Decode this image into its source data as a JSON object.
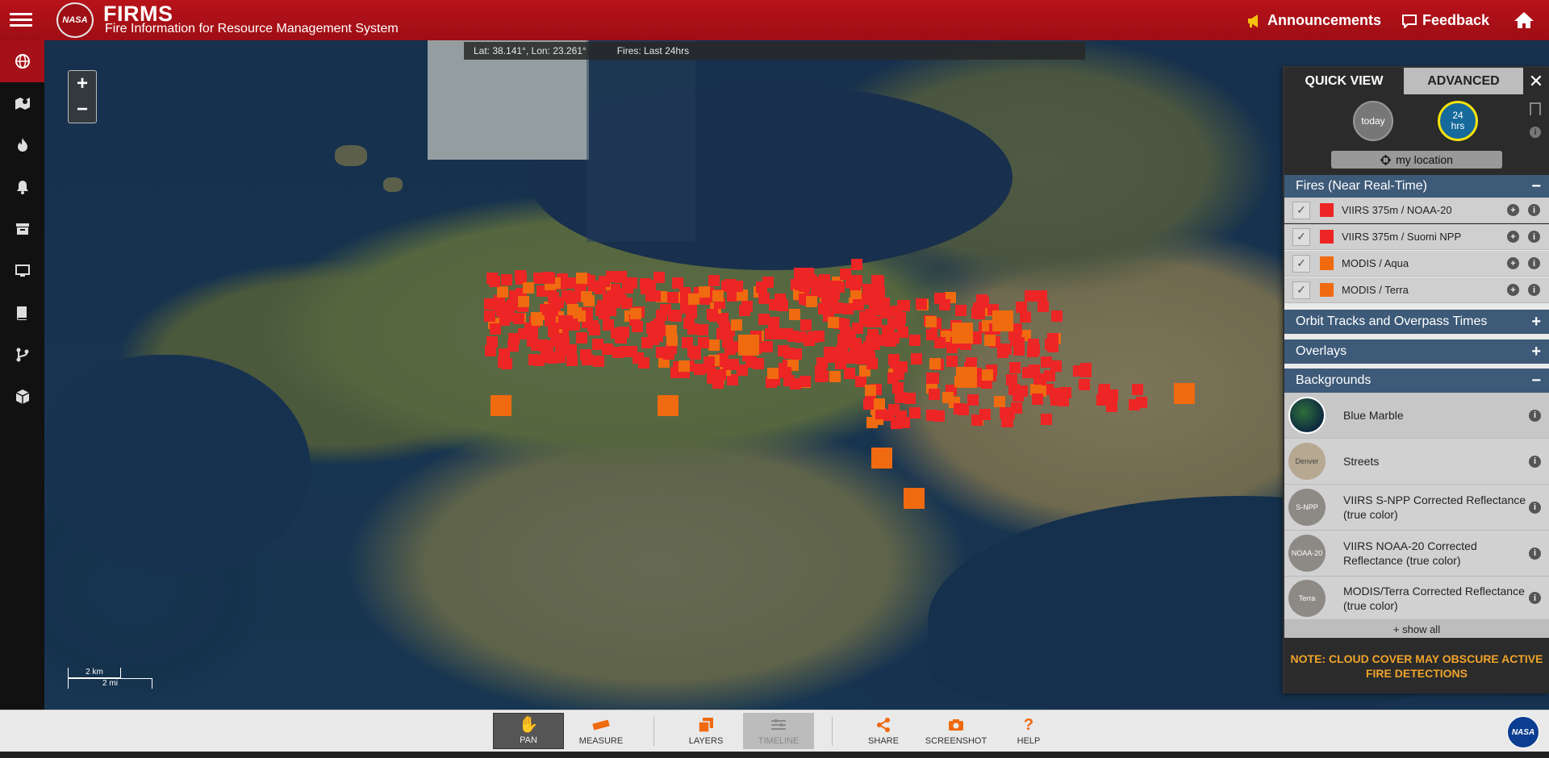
{
  "header": {
    "logo_text": "NASA",
    "title": "FIRMS",
    "subtitle": "Fire Information for Resource Management System",
    "announcements": "Announcements",
    "feedback": "Feedback"
  },
  "sidebar": {
    "items": [
      {
        "name": "globe-icon",
        "active": true
      },
      {
        "name": "map-marker-icon",
        "active": false
      },
      {
        "name": "fire-icon",
        "active": false
      },
      {
        "name": "bell-icon",
        "active": false
      },
      {
        "name": "archive-icon",
        "active": false
      },
      {
        "name": "monitor-icon",
        "active": false
      },
      {
        "name": "book-icon",
        "active": false
      },
      {
        "name": "branch-icon",
        "active": false
      },
      {
        "name": "cube-icon",
        "active": false
      }
    ]
  },
  "coordbar": {
    "location": "Lat: 38.141°, Lon: 23.261°",
    "fires": "Fires: Last 24hrs"
  },
  "zoom": {
    "in": "+",
    "out": "−"
  },
  "scale": {
    "km": "2 km",
    "mi": "2 mi"
  },
  "panel": {
    "tab_quick": "QUICK VIEW",
    "tab_advanced": "ADVANCED",
    "close": "✕",
    "today": "today",
    "hrs_num": "24",
    "hrs_label": "hrs",
    "my_location": "my location",
    "fires_section": "Fires (Near Real-Time)",
    "fires_toggle": "−",
    "fire_layers": [
      {
        "label": "VIIRS 375m / NOAA-20",
        "color": "#ed2525"
      },
      {
        "label": "VIIRS 375m / Suomi NPP",
        "color": "#ed2525"
      },
      {
        "label": "MODIS / Aqua",
        "color": "#f06a10"
      },
      {
        "label": "MODIS / Terra",
        "color": "#f06a10"
      }
    ],
    "orbit_section": "Orbit Tracks and Overpass Times",
    "overlays_section": "Overlays",
    "backgrounds_section": "Backgrounds",
    "plus": "+",
    "backgrounds": [
      {
        "label": "Blue Marble",
        "thumb": ""
      },
      {
        "label": "Streets",
        "thumb": "Denver"
      },
      {
        "label": "VIIRS S-NPP Corrected Reflectance (true color)",
        "thumb": "S-NPP"
      },
      {
        "label": "VIIRS NOAA-20 Corrected Reflectance (true color)",
        "thumb": "NOAA-20"
      },
      {
        "label": "MODIS/Terra Corrected Reflectance (true color)",
        "thumb": "Terra"
      }
    ],
    "show_all": "+ show all",
    "note": "NOTE: CLOUD COVER MAY OBSCURE ACTIVE FIRE DETECTIONS"
  },
  "toolbar": {
    "pan": "PAN",
    "measure": "MEASURE",
    "layers": "LAYERS",
    "timeline": "TIMELINE",
    "share": "SHARE",
    "screenshot": "SCREENSHOT",
    "help": "HELP"
  },
  "colors": {
    "brand": "#a51119",
    "fire_viirs": "#ed2525",
    "fire_modis": "#f06a10",
    "section": "#3d5a78",
    "note": "#f0a32a"
  }
}
